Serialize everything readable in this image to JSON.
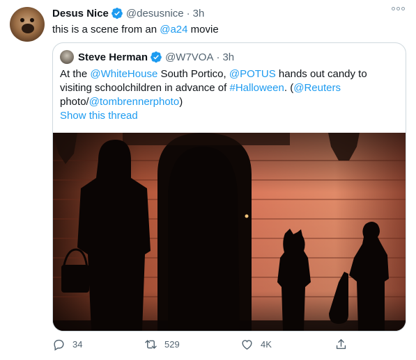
{
  "tweet": {
    "author": {
      "name": "Desus Nice",
      "handle": "@desusnice",
      "time": "3h"
    },
    "text_before": "this is a scene from an ",
    "text_mention": "@a24",
    "text_after": " movie",
    "quoted": {
      "author": {
        "name": "Steve Herman",
        "handle": "@W7VOA",
        "time": "3h"
      },
      "segments": [
        {
          "t": "At the ",
          "link": false
        },
        {
          "t": "@WhiteHouse",
          "link": true
        },
        {
          "t": " South Portico, ",
          "link": false
        },
        {
          "t": "@POTUS",
          "link": true
        },
        {
          "t": " hands out candy to visiting schoolchildren in advance of ",
          "link": false
        },
        {
          "t": "#Halloween",
          "link": true
        },
        {
          "t": ". (",
          "link": false
        },
        {
          "t": "@Reuters",
          "link": true
        },
        {
          "t": " photo/",
          "link": false
        },
        {
          "t": "@tombrennerphoto",
          "link": true
        },
        {
          "t": ")",
          "link": false
        }
      ],
      "show_thread": "Show this thread"
    },
    "actions": {
      "replies": "34",
      "retweets": "529",
      "likes": "4K"
    }
  },
  "colors": {
    "link": "#1d9bf0",
    "secondary_text": "#536471",
    "border": "#cfd9de",
    "verified": "#1d9bf0"
  },
  "icons": [
    "more-options-icon",
    "verified-icon",
    "reply-icon",
    "retweet-icon",
    "like-icon",
    "share-icon"
  ]
}
